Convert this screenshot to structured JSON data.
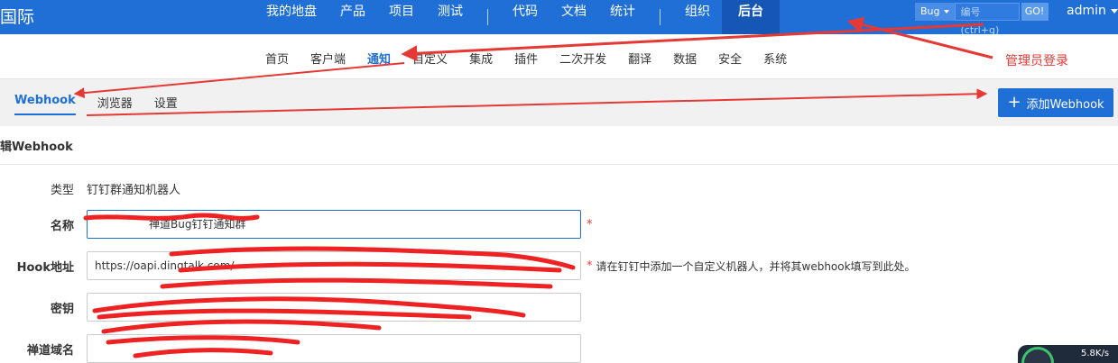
{
  "topbar": {
    "brand": "国际",
    "nav_items": [
      "我的地盘",
      "产品",
      "项目",
      "测试"
    ],
    "nav_items_2": [
      "代码",
      "文档",
      "统计"
    ],
    "nav_items_3": [
      "组织"
    ],
    "nav_active": "后台",
    "search_select": "Bug",
    "search_placeholder": "编号(ctrl+g)",
    "go_label": "GO!",
    "user": "admin"
  },
  "subnav": {
    "items": [
      "首页",
      "客户端",
      "通知",
      "自定义",
      "集成",
      "插件",
      "二次开发",
      "翻译",
      "数据",
      "安全",
      "系统"
    ],
    "active_index": 2
  },
  "annotation": {
    "admin_login": "管理员登录"
  },
  "tabs": {
    "items": [
      "Webhook",
      "浏览器",
      "设置"
    ],
    "active_index": 0,
    "add_button": "添加Webhook"
  },
  "form": {
    "title": "辑Webhook",
    "type_label": "类型",
    "type_value": "钉钉群通知机器人",
    "name_label": "名称",
    "name_value": "禅道Bug钉钉通知群",
    "hook_label": "Hook地址",
    "hook_value": "https://oapi.dingtalk.com/",
    "hook_hint": "请在钉钉中添加一个自定义机器人，并将其webhook填写到此处。",
    "secret_label": "密钥",
    "domain_label": "禅道域名",
    "required_mark": "*"
  },
  "status": {
    "rate": "5.8K/s"
  },
  "colors": {
    "primary": "#1f6fd6",
    "annotation_red": "#e53935"
  }
}
